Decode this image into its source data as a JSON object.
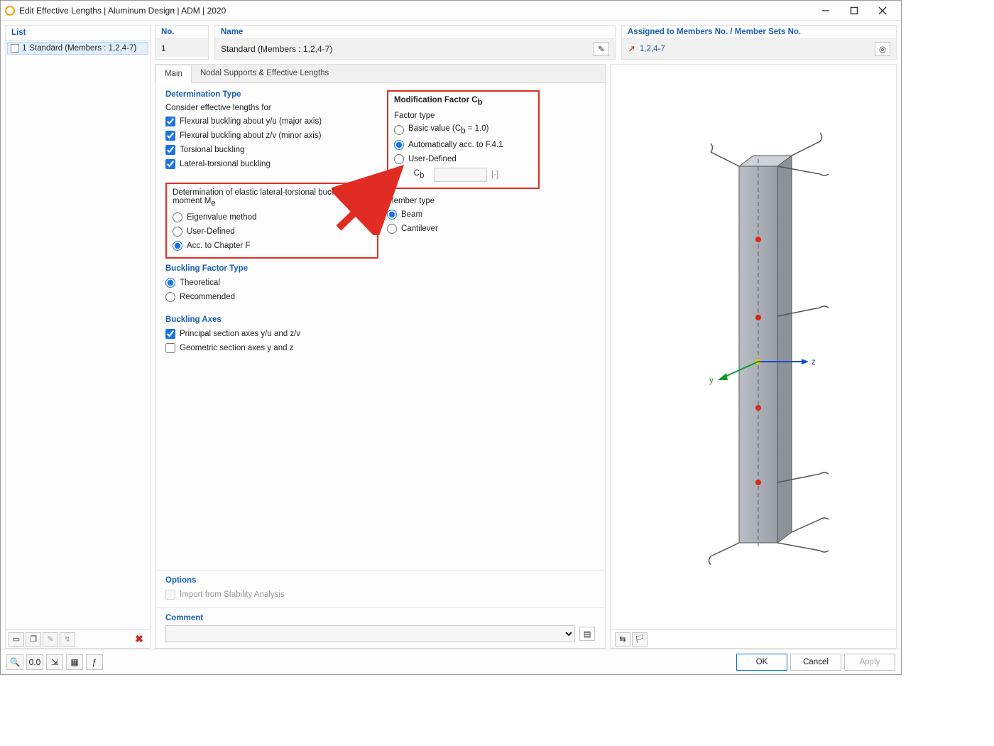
{
  "window_title": "Edit Effective Lengths | Aluminum Design | ADM | 2020",
  "list": {
    "header": "List",
    "item_no": "1",
    "item_label": "Standard (Members : 1,2,4-7)"
  },
  "header": {
    "no_label": "No.",
    "no_value": "1",
    "name_label": "Name",
    "name_value": "Standard (Members : 1,2,4-7)",
    "assigned_label": "Assigned to Members No. / Member Sets No.",
    "assigned_value": "1,2,4-7"
  },
  "tabs": {
    "main": "Main",
    "nodal": "Nodal Supports & Effective Lengths"
  },
  "determination": {
    "title": "Determination Type",
    "consider_label": "Consider effective lengths for",
    "flex_yu": "Flexural buckling about y/u (major axis)",
    "flex_zv": "Flexural buckling about z/v (minor axis)",
    "torsional": "Torsional buckling",
    "lat_tors": "Lateral-torsional buckling",
    "elastic_title": "Determination of elastic lateral-torsional buckling moment M",
    "elastic_sub": "e",
    "eigen": "Eigenvalue method",
    "userdef": "User-Defined",
    "chapterf": "Acc. to Chapter F"
  },
  "buckling_factor": {
    "title": "Buckling Factor Type",
    "theoretical": "Theoretical",
    "recommended": "Recommended"
  },
  "buckling_axes": {
    "title": "Buckling Axes",
    "principal": "Principal section axes y/u and z/v",
    "geometric": "Geometric section axes y and z"
  },
  "options": {
    "title": "Options",
    "import": "Import from Stability Analysis"
  },
  "modification": {
    "title": "Modification Factor C",
    "title_sub": "b",
    "factor_type": "Factor type",
    "basic": "Basic value (C",
    "basic_sub": "b",
    "basic_tail": " = 1.0)",
    "auto": "Automatically acc. to F.4.1",
    "userdef": "User-Defined",
    "cb_lbl": "C",
    "cb_sub": "b",
    "cb_unit": "[-]"
  },
  "member_type": {
    "title": "Member type",
    "beam": "Beam",
    "cantilever": "Cantilever"
  },
  "comment": {
    "title": "Comment"
  },
  "footer": {
    "ok": "OK",
    "cancel": "Cancel",
    "apply": "Apply"
  },
  "axes": {
    "y": "y",
    "z": "z"
  }
}
